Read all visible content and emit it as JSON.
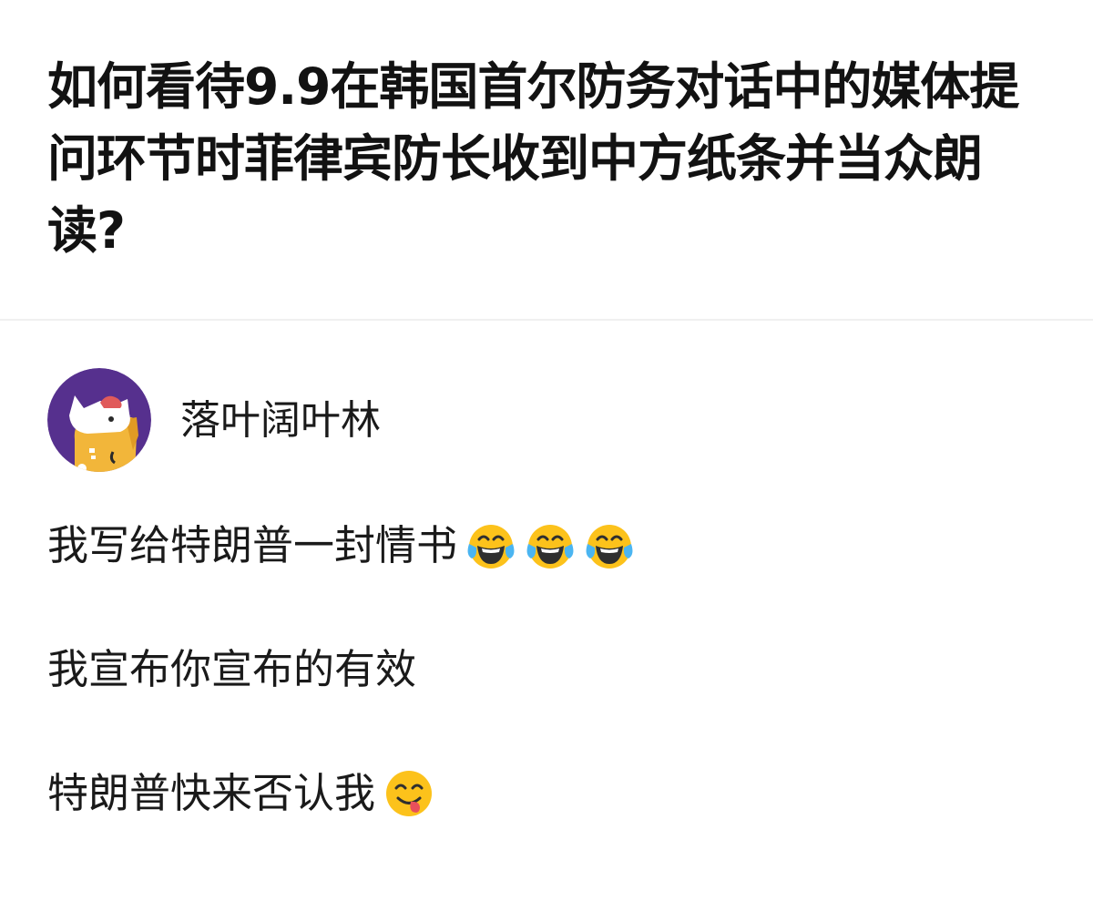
{
  "question": {
    "title": "如何看待9.9在韩国首尔防务对话中的媒体提问环节时菲律宾防长收到中方纸条并当众朗读?"
  },
  "answer": {
    "author": {
      "name": "落叶阔叶林",
      "avatar_icon": "avatar-illustration-icon"
    },
    "paragraphs": [
      {
        "text": "我写给特朗普一封情书",
        "emojis": [
          "laughing-crying-emoji-icon",
          "laughing-crying-emoji-icon",
          "laughing-crying-emoji-icon"
        ]
      },
      {
        "text": "我宣布你宣布的有效",
        "emojis": []
      },
      {
        "text": "特朗普快来否认我",
        "emojis": [
          "yum-tongue-emoji-icon"
        ]
      }
    ]
  },
  "colors": {
    "text": "#1a1a1a",
    "title": "#121212",
    "divider": "#f0f0f0",
    "avatar_bg": "#56308e",
    "emoji_face": "#fcc21b",
    "emoji_tears": "#4bb5f1"
  }
}
